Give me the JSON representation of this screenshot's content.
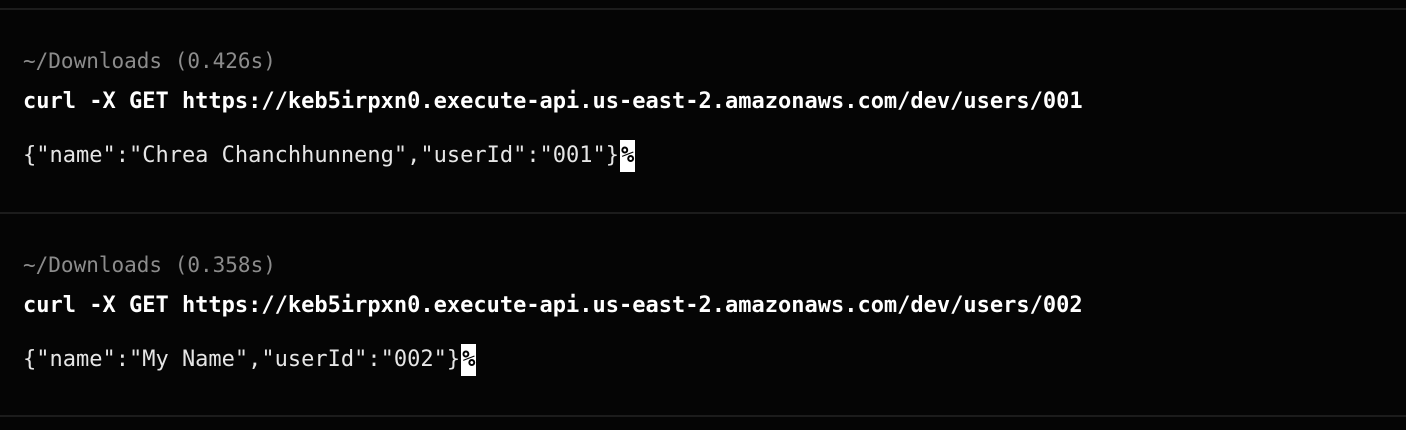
{
  "terminal": {
    "blocks": [
      {
        "prompt": "~/Downloads (0.426s)",
        "command": "curl -X GET https://keb5irpxn0.execute-api.us-east-2.amazonaws.com/dev/users/001",
        "output": "{\"name\":\"Chrea Chanchhunneng\",\"userId\":\"001\"}",
        "end_marker": "%"
      },
      {
        "prompt": "~/Downloads (0.358s)",
        "command": "curl -X GET https://keb5irpxn0.execute-api.us-east-2.amazonaws.com/dev/users/002",
        "output": "{\"name\":\"My Name\",\"userId\":\"002\"}",
        "end_marker": "%"
      }
    ]
  },
  "colors": {
    "background": "#050505",
    "divider": "#1c1c1c",
    "prompt_text": "#8c8c8c",
    "command_text": "#ffffff",
    "output_text": "#e6e6e6"
  }
}
